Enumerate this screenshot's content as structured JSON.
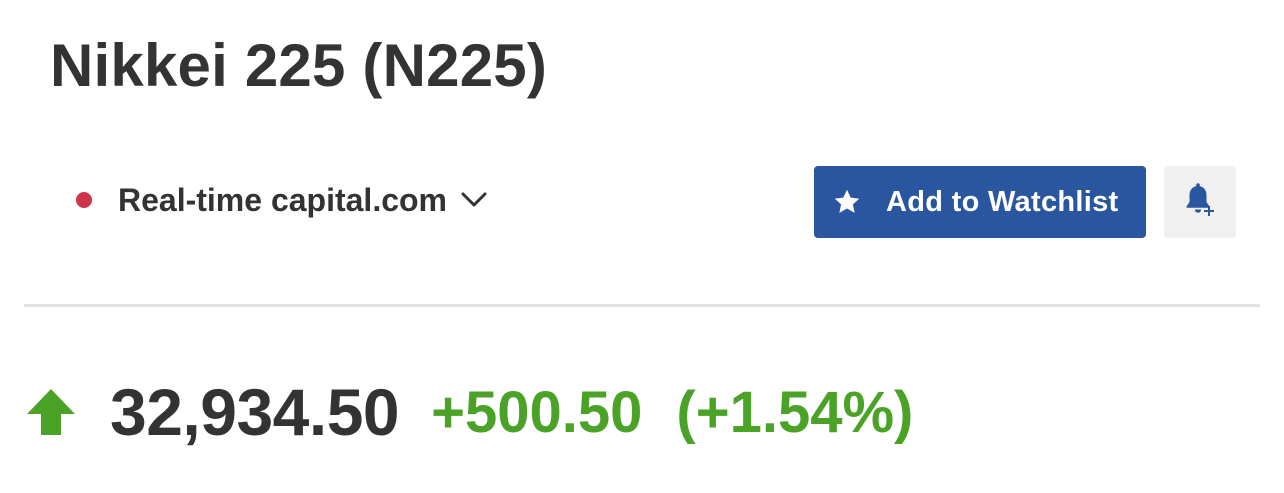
{
  "instrument": {
    "title": "Nikkei 225 (N225)"
  },
  "source": {
    "status_icon": "live-dot",
    "status_color": "#d0334a",
    "label": "Real-time capital.com",
    "dropdown_icon": "chevron-down-icon"
  },
  "actions": {
    "watchlist_label": "Add to Watchlist",
    "watchlist_icon": "star-icon",
    "watchlist_color": "#2a56a0",
    "alert_icon": "bell-plus-icon"
  },
  "quote": {
    "direction_icon": "arrow-up-icon",
    "price": "32,934.50",
    "change": "+500.50",
    "change_percent": "(+1.54%)",
    "positive_color": "#4aa326"
  }
}
